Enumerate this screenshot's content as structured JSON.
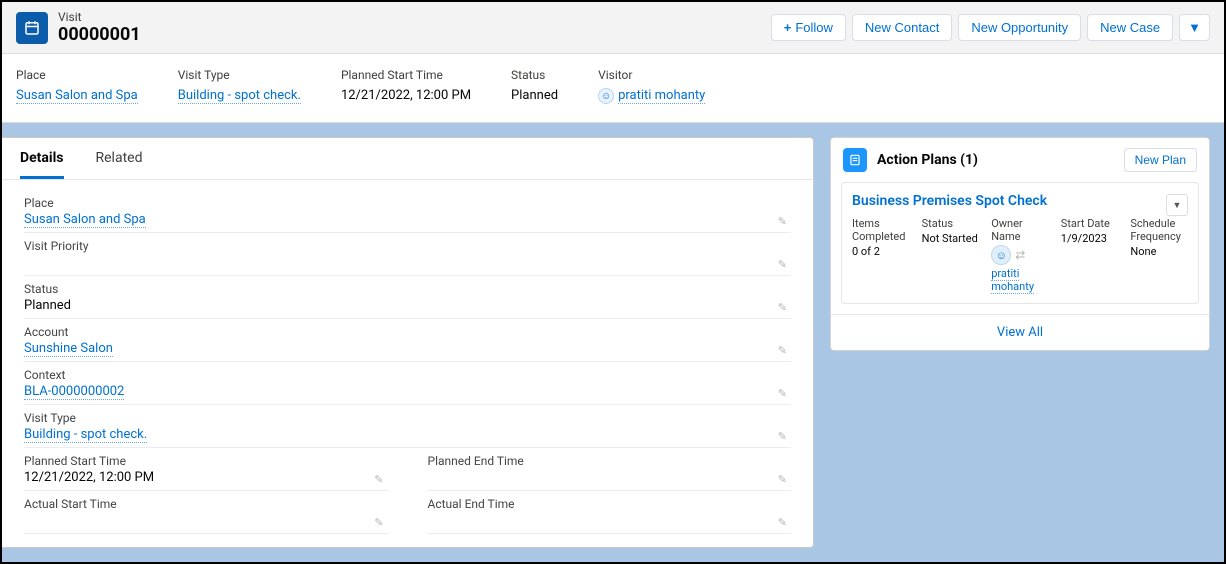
{
  "header": {
    "entity_label": "Visit",
    "record_number": "00000001",
    "actions": {
      "follow": "Follow",
      "new_contact": "New Contact",
      "new_opportunity": "New Opportunity",
      "new_case": "New Case"
    }
  },
  "highlights": {
    "place": {
      "label": "Place",
      "value": "Susan Salon and Spa"
    },
    "visit_type": {
      "label": "Visit Type",
      "value": "Building - spot check."
    },
    "planned_start": {
      "label": "Planned Start Time",
      "value": "12/21/2022, 12:00 PM"
    },
    "status": {
      "label": "Status",
      "value": "Planned"
    },
    "visitor": {
      "label": "Visitor",
      "value": "pratiti mohanty"
    }
  },
  "tabs": {
    "details": "Details",
    "related": "Related"
  },
  "details": {
    "place": {
      "label": "Place",
      "value": "Susan Salon and Spa"
    },
    "visit_priority": {
      "label": "Visit Priority",
      "value": ""
    },
    "status": {
      "label": "Status",
      "value": "Planned"
    },
    "account": {
      "label": "Account",
      "value": "Sunshine Salon"
    },
    "context": {
      "label": "Context",
      "value": "BLA-0000000002"
    },
    "visit_type": {
      "label": "Visit Type",
      "value": "Building - spot check."
    },
    "planned_start": {
      "label": "Planned Start Time",
      "value": "12/21/2022, 12:00 PM"
    },
    "planned_end": {
      "label": "Planned End Time",
      "value": ""
    },
    "actual_start": {
      "label": "Actual Start Time",
      "value": ""
    },
    "actual_end": {
      "label": "Actual End Time",
      "value": ""
    }
  },
  "action_plans": {
    "title": "Action Plans (1)",
    "new_plan": "New Plan",
    "plan": {
      "name": "Business Premises Spot Check",
      "items_completed": {
        "label": "Items Completed",
        "value": "0 of 2"
      },
      "status": {
        "label": "Status",
        "value": "Not Started"
      },
      "owner": {
        "label": "Owner Name",
        "value": "pratiti mohanty"
      },
      "start_date": {
        "label": "Start Date",
        "value": "1/9/2023"
      },
      "schedule": {
        "label": "Schedule Frequency",
        "value": "None"
      }
    },
    "view_all": "View All"
  }
}
